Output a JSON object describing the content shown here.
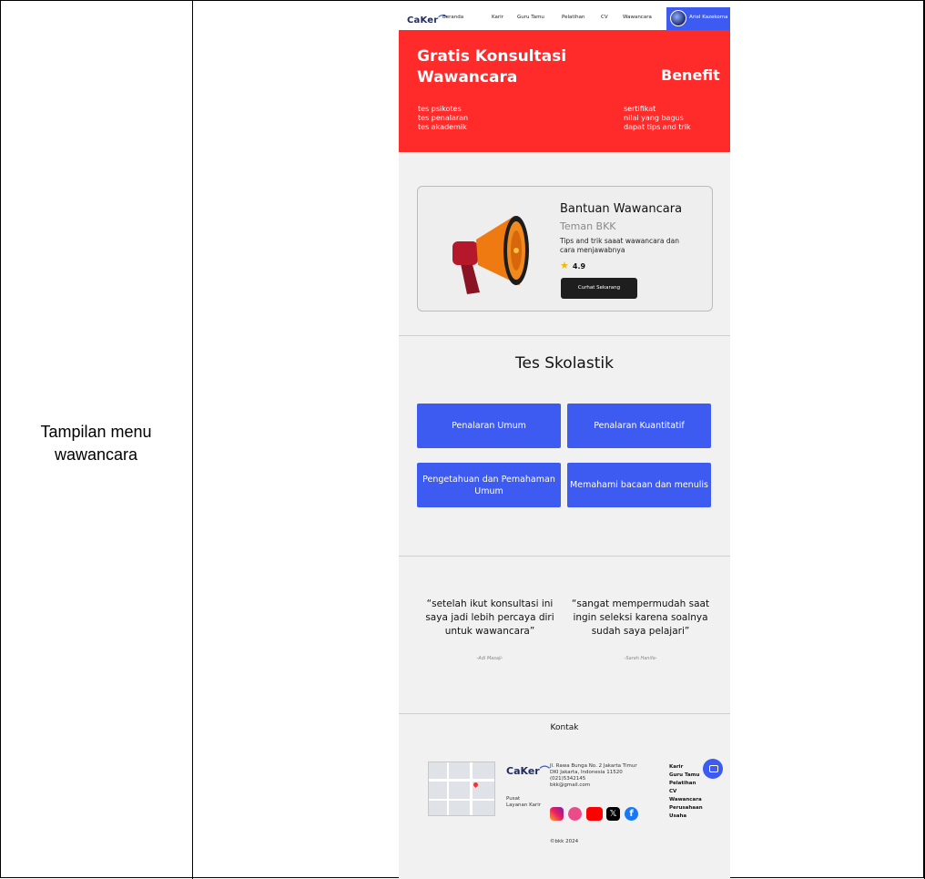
{
  "document": {
    "caption": "Tampilan menu wawancara"
  },
  "nav": {
    "logo": "CaKer",
    "items": [
      "Beranda",
      "Karir",
      "Guru Tamu",
      "Pelatihan",
      "CV",
      "Wawancara"
    ],
    "user": "Ariel Kazekoma"
  },
  "hero": {
    "title": "Gratis Konsultasi Wawancara",
    "left_items": [
      "tes psikotes",
      "tes penalaran",
      "tes akademik"
    ],
    "benefit_title": "Benefit",
    "right_items": [
      "sertifikat",
      "nilai yang bagus",
      "dapat tips and trik"
    ]
  },
  "card": {
    "title": "Bantuan Wawancara",
    "subtitle": "Teman BKK",
    "description": "Tips and trik saaat wawancara dan cara menjawabnya",
    "rating": "4.9",
    "button": "Curhat Sekarang",
    "icon": "megaphone-icon"
  },
  "skolastik": {
    "title": "Tes Skolastik",
    "buttons": [
      "Penalaran Umum",
      "Penalaran Kuantitatif",
      "Pengetahuan dan Pemahaman Umum",
      "Memahami bacaan dan menulis"
    ]
  },
  "testimonials": [
    {
      "quote": "“setelah ikut konsultasi ini saya jadi lebih percaya diri untuk wawancara”",
      "author": "-Adi Masaji-"
    },
    {
      "quote": "“sangat mempermudah saat ingin seleksi karena soalnya sudah saya pelajari”",
      "author": "-Sarah Hanifa-"
    }
  ],
  "footer": {
    "title": "Kontak",
    "logo": "CaKer",
    "pusat": "Pusat Layanan Karir",
    "address": [
      "Jl. Rawa Bunga No. 2 Jakarta Timur",
      "DKI Jakarta, Indonesia 11520",
      "(021)5342145",
      "bkk@gmail.com"
    ],
    "links": [
      "Karir",
      "Guru Tamu",
      "Pelatihan",
      "CV",
      "Wawancara",
      "Perusahaan",
      "Usaha"
    ],
    "copyright": "©bkk 2024",
    "socials": [
      "instagram-icon",
      "dribbble-icon",
      "youtube-icon",
      "x-icon",
      "facebook-icon"
    ]
  },
  "colors": {
    "primary_blue": "#3d5af1",
    "hero_red": "#ff2a2a",
    "dark_button": "#1e1e1e"
  }
}
